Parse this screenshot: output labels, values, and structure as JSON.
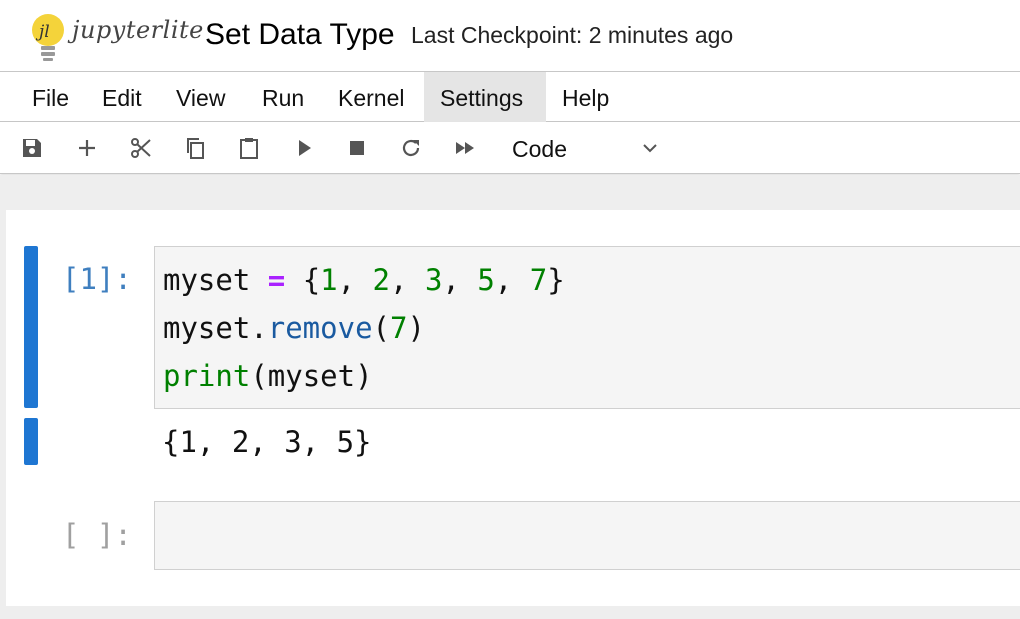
{
  "header": {
    "logo_text": "jupyterlite",
    "notebook_title": "Set Data Type",
    "checkpoint": "Last Checkpoint: 2 minutes ago"
  },
  "menu": {
    "items": [
      {
        "label": "File"
      },
      {
        "label": "Edit"
      },
      {
        "label": "View"
      },
      {
        "label": "Run"
      },
      {
        "label": "Kernel"
      },
      {
        "label": "Settings"
      },
      {
        "label": "Help"
      }
    ],
    "active": "Settings"
  },
  "toolbar": {
    "icons": [
      "save-icon",
      "add-icon",
      "cut-icon",
      "copy-icon",
      "paste-icon",
      "run-icon",
      "stop-icon",
      "restart-icon",
      "fast-forward-icon"
    ],
    "cell_type": "Code"
  },
  "cells": [
    {
      "prompt": "[1]:",
      "code_lines": [
        {
          "t1": "myset ",
          "op": "=",
          "t2": " {",
          "n1": "1",
          "c1": ", ",
          "n2": "2",
          "c2": ", ",
          "n3": "3",
          "c3": ", ",
          "n4": "5",
          "c4": ", ",
          "n5": "7",
          "t3": "}"
        },
        {
          "obj": "myset.",
          "method": "remove",
          "open": "(",
          "arg": "7",
          "close": ")"
        },
        {
          "builtin": "print",
          "rest": "(myset)"
        }
      ],
      "output": "{1, 2, 3, 5}"
    },
    {
      "prompt": "[ ]:"
    }
  ],
  "colors": {
    "active_bar": "#1e76d2",
    "prompt_blue": "#3f7fbf",
    "number_green": "#008000",
    "operator_purple": "#aa22ff",
    "method_blue": "#1a5aa0"
  }
}
